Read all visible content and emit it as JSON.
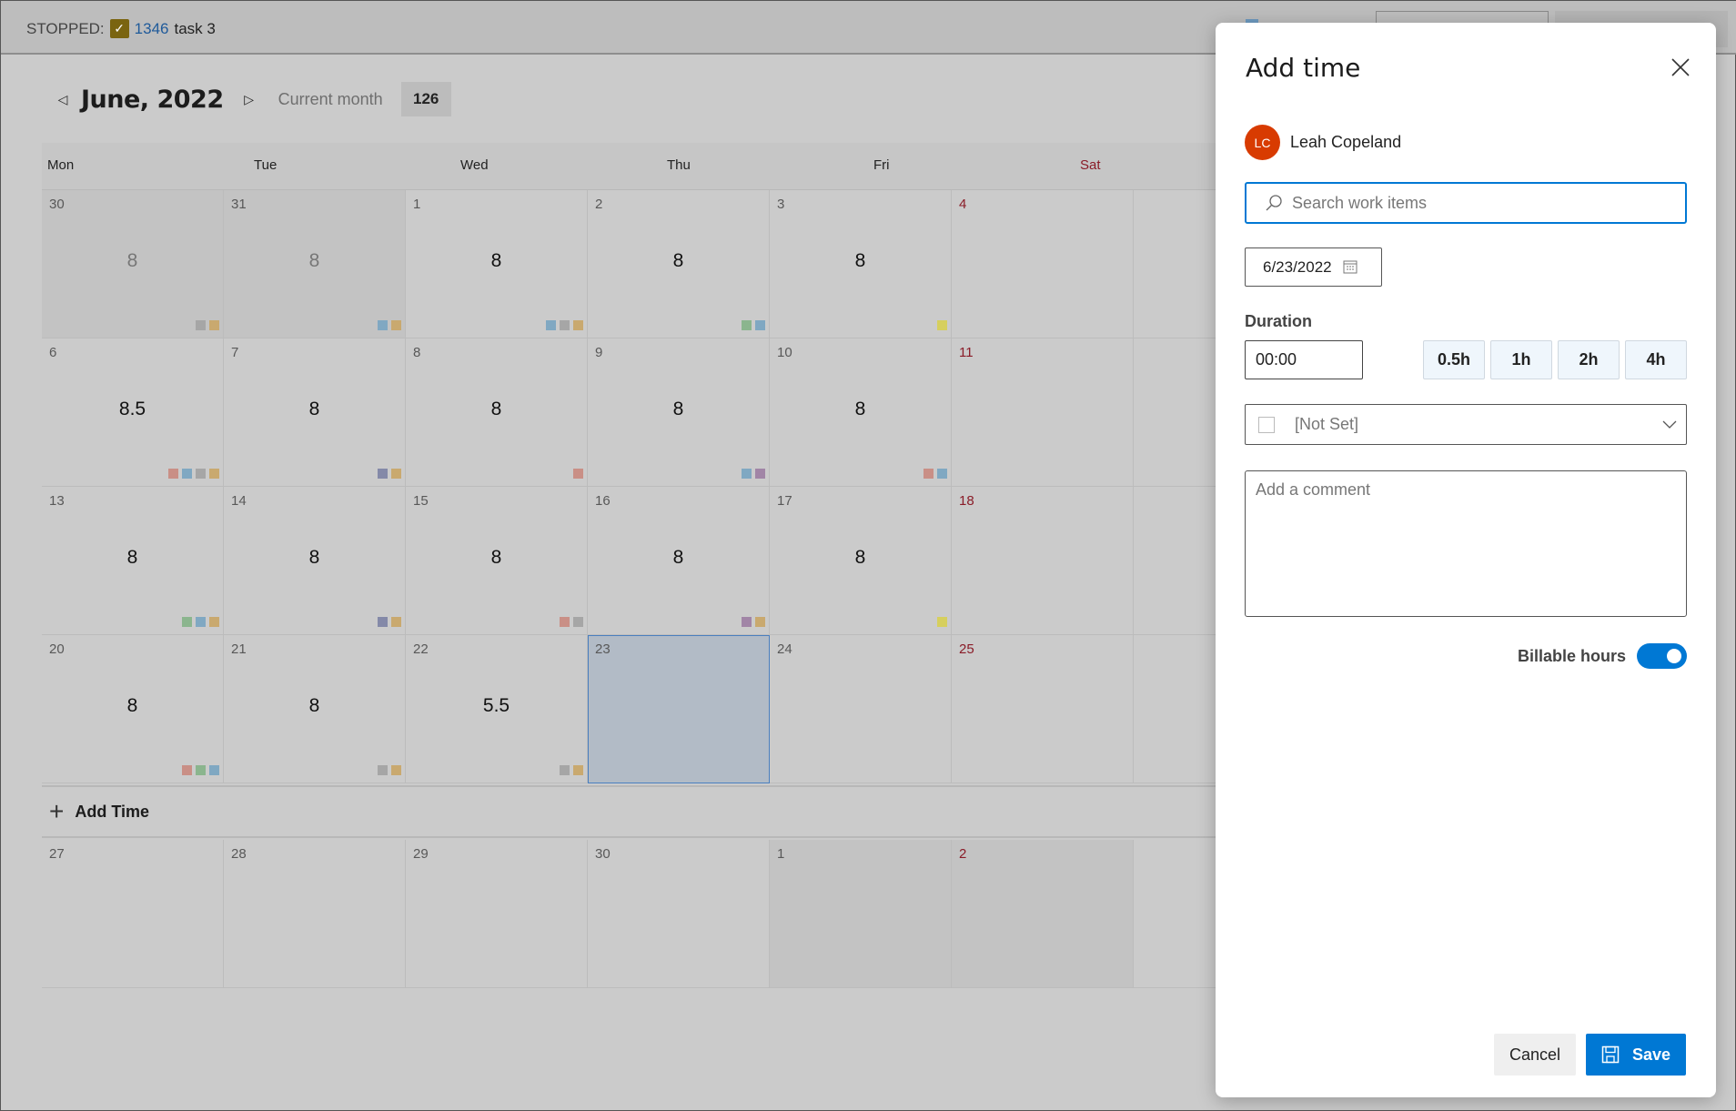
{
  "status_bar": {
    "state": "STOPPED:",
    "task_id": "1346",
    "task_name": "task 3"
  },
  "calendar": {
    "month_title": "June, 2022",
    "current_month_label": "Current month",
    "month_total": "126",
    "weekdays": [
      "Mon",
      "Tue",
      "Wed",
      "Thu",
      "Fri",
      "Sat"
    ],
    "weeks": [
      [
        {
          "d": "30",
          "h": "8",
          "other": true,
          "c": [
            "gray",
            "tan"
          ]
        },
        {
          "d": "31",
          "h": "8",
          "other": true,
          "c": [
            "blue",
            "tan"
          ]
        },
        {
          "d": "1",
          "h": "8",
          "c": [
            "blue",
            "gray",
            "tan"
          ]
        },
        {
          "d": "2",
          "h": "8",
          "c": [
            "green",
            "blue"
          ]
        },
        {
          "d": "3",
          "h": "8",
          "c": [
            "yellow"
          ]
        },
        {
          "d": "4",
          "h": "",
          "c": []
        }
      ],
      [
        {
          "d": "6",
          "h": "8.5",
          "c": [
            "red",
            "blue",
            "gray",
            "tan"
          ]
        },
        {
          "d": "7",
          "h": "8",
          "c": [
            "navy",
            "tan"
          ]
        },
        {
          "d": "8",
          "h": "8",
          "c": [
            "red"
          ]
        },
        {
          "d": "9",
          "h": "8",
          "c": [
            "blue",
            "purple"
          ]
        },
        {
          "d": "10",
          "h": "8",
          "c": [
            "red",
            "blue"
          ]
        },
        {
          "d": "11",
          "h": "",
          "c": []
        }
      ],
      [
        {
          "d": "13",
          "h": "8",
          "c": [
            "green",
            "blue",
            "tan"
          ]
        },
        {
          "d": "14",
          "h": "8",
          "c": [
            "navy",
            "tan"
          ]
        },
        {
          "d": "15",
          "h": "8",
          "c": [
            "red",
            "gray"
          ]
        },
        {
          "d": "16",
          "h": "8",
          "c": [
            "purple",
            "tan"
          ]
        },
        {
          "d": "17",
          "h": "8",
          "c": [
            "yellow"
          ]
        },
        {
          "d": "18",
          "h": "",
          "c": []
        }
      ],
      [
        {
          "d": "20",
          "h": "8",
          "c": [
            "red",
            "green",
            "blue"
          ]
        },
        {
          "d": "21",
          "h": "8",
          "c": [
            "gray",
            "tan"
          ]
        },
        {
          "d": "22",
          "h": "5.5",
          "c": [
            "gray",
            "tan"
          ]
        },
        {
          "d": "23",
          "h": "",
          "selected": true,
          "c": []
        },
        {
          "d": "24",
          "h": "",
          "c": []
        },
        {
          "d": "25",
          "h": "",
          "c": []
        }
      ],
      [
        {
          "d": "27",
          "h": "",
          "c": []
        },
        {
          "d": "28",
          "h": "",
          "c": []
        },
        {
          "d": "29",
          "h": "",
          "c": []
        },
        {
          "d": "30",
          "h": "",
          "c": []
        },
        {
          "d": "1",
          "h": "",
          "other": true,
          "c": []
        },
        {
          "d": "2",
          "h": "",
          "other": true,
          "c": []
        }
      ]
    ],
    "add_time_label": "Add Time",
    "add_after_week": 3
  },
  "colors": {
    "gray": "#a6a6a6",
    "tan": "#c9a96f",
    "blue": "#80a8c2",
    "green": "#8bb58e",
    "red": "#c98f86",
    "navy": "#8489a8",
    "purple": "#a185a6",
    "yellow": "#d6cf5e",
    "accent": "#0078d4",
    "weekend": "#8a1c28",
    "avatar": "#d83b01"
  },
  "panel": {
    "title": "Add time",
    "user_initials": "LC",
    "user_name": "Leah Copeland",
    "search_placeholder": "Search work items",
    "search_value": "",
    "date": "6/23/2022",
    "duration_label": "Duration",
    "duration_value": "00:00",
    "quick_buttons": [
      "0.5h",
      "1h",
      "2h",
      "4h"
    ],
    "activity_value": "[Not Set]",
    "comment_placeholder": "Add a comment",
    "billable_label": "Billable hours",
    "billable_on": true,
    "cancel_label": "Cancel",
    "save_label": "Save"
  }
}
